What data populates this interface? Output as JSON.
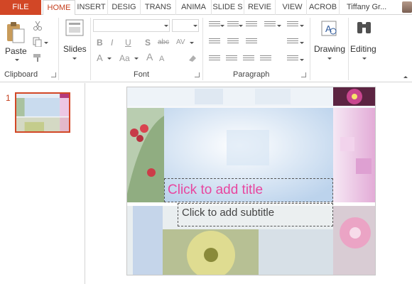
{
  "tabs": [
    {
      "label": "FILE",
      "active": false
    },
    {
      "label": "HOME",
      "active": true
    },
    {
      "label": "INSERT",
      "active": false
    },
    {
      "label": "DESIG",
      "active": false
    },
    {
      "label": "TRANS",
      "active": false
    },
    {
      "label": "ANIMA",
      "active": false
    },
    {
      "label": "SLIDE S",
      "active": false
    },
    {
      "label": "REVIE",
      "active": false
    },
    {
      "label": "VIEW",
      "active": false
    },
    {
      "label": "ACROB",
      "active": false
    }
  ],
  "user": {
    "name": "Tiffany Gr..."
  },
  "ribbon": {
    "clipboard": {
      "paste_label": "Paste",
      "group_label": "Clipboard"
    },
    "slides": {
      "label": "Slides"
    },
    "font": {
      "group_label": "Font",
      "font_name": "",
      "font_size": ""
    },
    "paragraph": {
      "group_label": "Paragraph"
    },
    "drawing": {
      "label": "Drawing"
    },
    "editing": {
      "label": "Editing"
    }
  },
  "thumbnails": [
    {
      "number": "1"
    }
  ],
  "slide": {
    "title_placeholder": "Click to add title",
    "subtitle_placeholder": "Click to add subtitle",
    "colors": {
      "title": "#e8469f",
      "subtitle": "#444444",
      "accent": "#d24726"
    }
  },
  "icons": [
    "cut-icon",
    "copy-icon",
    "format-painter-icon",
    "bold-icon",
    "italic-icon",
    "underline-icon",
    "shadow-icon",
    "strikethrough-icon",
    "character-spacing-icon",
    "font-color-icon",
    "grow-font-icon",
    "shrink-font-icon",
    "change-case-icon",
    "clear-formatting-icon",
    "bullets-icon",
    "numbering-icon",
    "decrease-indent-icon",
    "increase-indent-icon",
    "line-spacing-icon",
    "align-left-icon",
    "center-icon",
    "align-right-icon",
    "justify-icon",
    "columns-icon",
    "text-direction-icon",
    "align-text-icon",
    "smartart-icon",
    "drawing-icon",
    "binoculars-icon"
  ]
}
